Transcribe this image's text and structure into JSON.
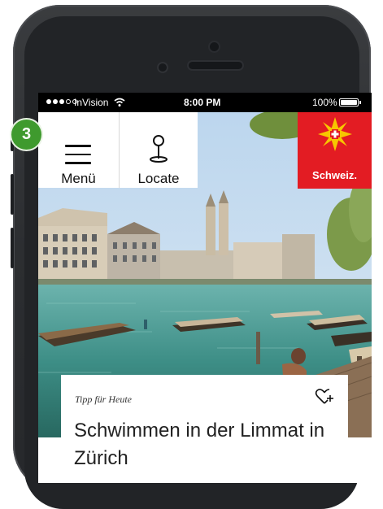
{
  "status_bar": {
    "carrier": "InVision",
    "time": "8:00 PM",
    "battery": "100%"
  },
  "nav": {
    "menu_label": "Menü",
    "locate_label": "Locate"
  },
  "logo": {
    "text": "Schweiz."
  },
  "card": {
    "kicker": "Tipp für Heute",
    "title": "Schwimmen in der Limmat in Zürich"
  },
  "step_badge": "3",
  "colors": {
    "logo_red": "#e31c23",
    "badge_green": "#3f9a2e",
    "phone_frame": "#2c2e31"
  },
  "icons": {
    "menu": "hamburger-icon",
    "locate": "location-pin-icon",
    "favorite": "heart-plus-icon",
    "logo": "swiss-star-icon",
    "wifi": "wifi-icon",
    "battery": "battery-icon"
  }
}
